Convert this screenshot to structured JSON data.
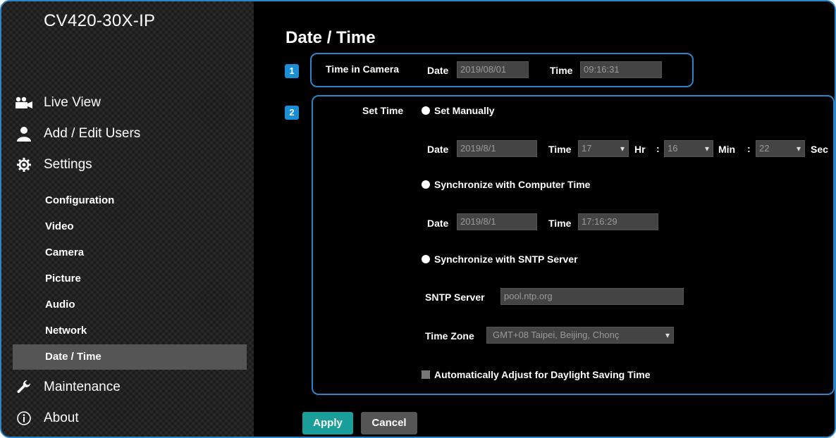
{
  "sidebar": {
    "model": "CV420-30X-IP",
    "main_items": [
      {
        "label": "Live View",
        "icon": "camera-icon"
      },
      {
        "label": "Add / Edit Users",
        "icon": "user-icon"
      },
      {
        "label": "Settings",
        "icon": "gear-icon"
      },
      {
        "label": "Maintenance",
        "icon": "wrench-icon"
      },
      {
        "label": "About",
        "icon": "info-icon"
      }
    ],
    "sub_items": [
      {
        "label": "Configuration"
      },
      {
        "label": "Video"
      },
      {
        "label": "Camera"
      },
      {
        "label": "Picture"
      },
      {
        "label": "Audio"
      },
      {
        "label": "Network"
      },
      {
        "label": "Date / Time",
        "active": true
      }
    ]
  },
  "page": {
    "title": "Date / Time",
    "badge1": "1",
    "badge2": "2"
  },
  "time_in_camera": {
    "label": "Time in Camera",
    "date_label": "Date",
    "date_value": "2019/08/01",
    "time_label": "Time",
    "time_value": "09:16:31"
  },
  "set_time": {
    "label": "Set Time",
    "manual": {
      "label": "Set Manually",
      "date_label": "Date",
      "date_value": "2019/8/1",
      "time_label": "Time",
      "hour_value": "17",
      "hr_label": "Hr",
      "colon": ":",
      "min_value": "16",
      "min_label": "Min",
      "sec_value": "22",
      "sec_label": "Sec"
    },
    "computer": {
      "label": "Synchronize with Computer Time",
      "date_label": "Date",
      "date_value": "2019/8/1",
      "time_label": "Time",
      "time_value": "17:16:29"
    },
    "sntp": {
      "label": "Synchronize with SNTP Server",
      "server_label": "SNTP Server",
      "server_value": "pool.ntp.org",
      "zone_label": "Time Zone",
      "zone_value": "GMT+08 Taipei, Beijing, Chonç",
      "dst_label": "Automatically Adjust for Daylight Saving Time"
    }
  },
  "buttons": {
    "apply": "Apply",
    "cancel": "Cancel"
  },
  "colors": {
    "accent_border": "#2a86c8",
    "badge": "#1a8fd6",
    "apply": "#1a9e9a",
    "cancel": "#555555"
  }
}
